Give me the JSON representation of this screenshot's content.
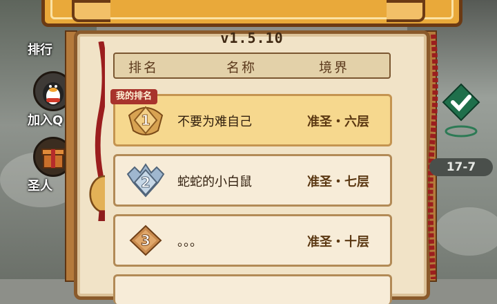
{
  "version": "v1.5.10",
  "columns": [
    "排名",
    "名称",
    "境界"
  ],
  "my_rank_tag": "我的排名",
  "rows": [
    {
      "rank": "1",
      "name": "不要为难自己",
      "realm": "准圣・六层",
      "is_mine": true
    },
    {
      "rank": "2",
      "name": "蛇蛇的小白鼠",
      "realm": "准圣・七层",
      "is_mine": false
    },
    {
      "rank": "3",
      "name": "。。。",
      "realm": "准圣・十层",
      "is_mine": false
    }
  ],
  "side_menu": [
    {
      "label": "排行",
      "icon": "ranking-icon"
    },
    {
      "label": "加入Q",
      "icon": "penguin-icon"
    },
    {
      "label": "圣人",
      "icon": "gift-icon"
    }
  ],
  "level_indicator": "17-7",
  "icons": {
    "check": "checkmark-icon"
  },
  "colors": {
    "gold_row": "#f6d88e",
    "card": "#f7ecd8",
    "tag_red": "#a8332c",
    "rope_red": "#9b1e1e"
  }
}
